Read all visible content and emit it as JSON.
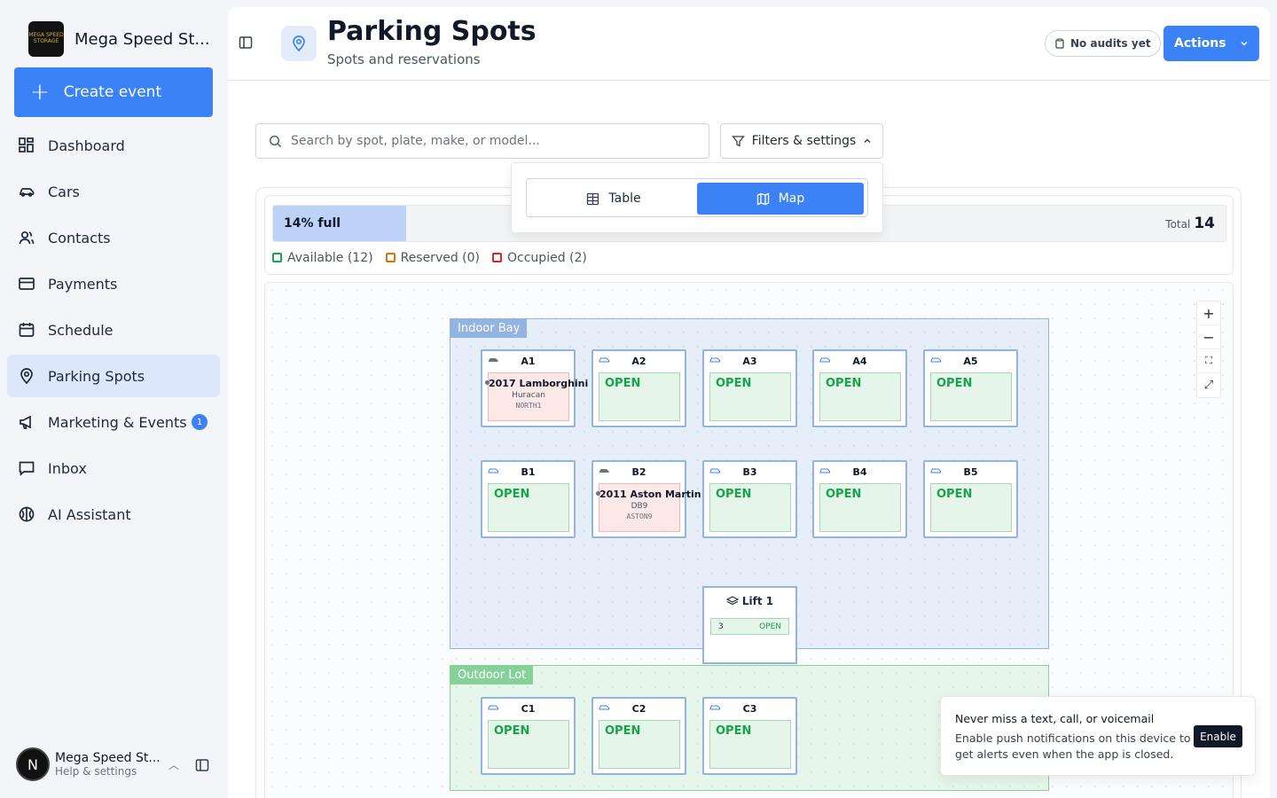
{
  "brand": {
    "name": "Mega Speed St...",
    "logo_text": "MEGA SPEED STORAGE"
  },
  "create_event": "Create event",
  "nav": [
    {
      "label": "Dashboard",
      "icon": "dashboard-icon"
    },
    {
      "label": "Cars",
      "icon": "car-icon"
    },
    {
      "label": "Contacts",
      "icon": "contacts-icon"
    },
    {
      "label": "Payments",
      "icon": "credit-card-icon"
    },
    {
      "label": "Schedule",
      "icon": "calendar-icon"
    },
    {
      "label": "Parking Spots",
      "icon": "map-pin-icon",
      "active": true
    },
    {
      "label": "Marketing & Events",
      "icon": "megaphone-icon",
      "badge": "1"
    },
    {
      "label": "Inbox",
      "icon": "inbox-icon"
    },
    {
      "label": "AI Assistant",
      "icon": "ai-icon"
    }
  ],
  "user": {
    "initial": "N",
    "name": "Mega Speed St...",
    "sub": "Help & settings"
  },
  "header": {
    "title": "Parking Spots",
    "subtitle": "Spots and reservations",
    "audit": "No audits yet",
    "actions": "Actions"
  },
  "search": {
    "placeholder": "Search by spot, plate, make, or model..."
  },
  "filters": {
    "label": "Filters & settings"
  },
  "view_toggle": {
    "table": "Table",
    "map": "Map",
    "selected": "Map"
  },
  "stats": {
    "fill_label": "14% full",
    "fill_fraction": 0.14,
    "total_label": "Total",
    "total_value": "14",
    "legend": [
      {
        "label": "Available (12)",
        "color": "#16a34a"
      },
      {
        "label": "Reserved (0)",
        "color": "#d97706"
      },
      {
        "label": "Occupied (2)",
        "color": "#dc2626"
      }
    ]
  },
  "zones": [
    {
      "name": "Indoor Bay",
      "color": "#93b4e3"
    },
    {
      "name": "Outdoor Lot",
      "color": "#86d19a"
    }
  ],
  "spots": {
    "A1": {
      "id": "A1",
      "status": "occupied",
      "title": "2017 Lamborghini",
      "model": "Huracan",
      "plate": "NORTH1"
    },
    "A2": {
      "id": "A2",
      "status": "OPEN"
    },
    "A3": {
      "id": "A3",
      "status": "OPEN"
    },
    "A4": {
      "id": "A4",
      "status": "OPEN"
    },
    "A5": {
      "id": "A5",
      "status": "OPEN"
    },
    "B1": {
      "id": "B1",
      "status": "OPEN"
    },
    "B2": {
      "id": "B2",
      "status": "occupied",
      "title": "2011 Aston Martin",
      "model": "DB9",
      "plate": "ASTON9"
    },
    "B3": {
      "id": "B3",
      "status": "OPEN"
    },
    "B4": {
      "id": "B4",
      "status": "OPEN"
    },
    "B5": {
      "id": "B5",
      "status": "OPEN"
    },
    "C1": {
      "id": "C1",
      "status": "OPEN"
    },
    "C2": {
      "id": "C2",
      "status": "OPEN"
    },
    "C3": {
      "id": "C3",
      "status": "OPEN"
    }
  },
  "lift": {
    "name": "Lift 1",
    "level": "3",
    "status": "OPEN"
  },
  "zoom": {
    "in": "+",
    "out": "−",
    "fit": "⛶",
    "expand": "⤢"
  },
  "toast": {
    "title": "Never miss a text, call, or voicemail",
    "body": "Enable push notifications on this device to get alerts even when the app is closed.",
    "button": "Enable"
  }
}
